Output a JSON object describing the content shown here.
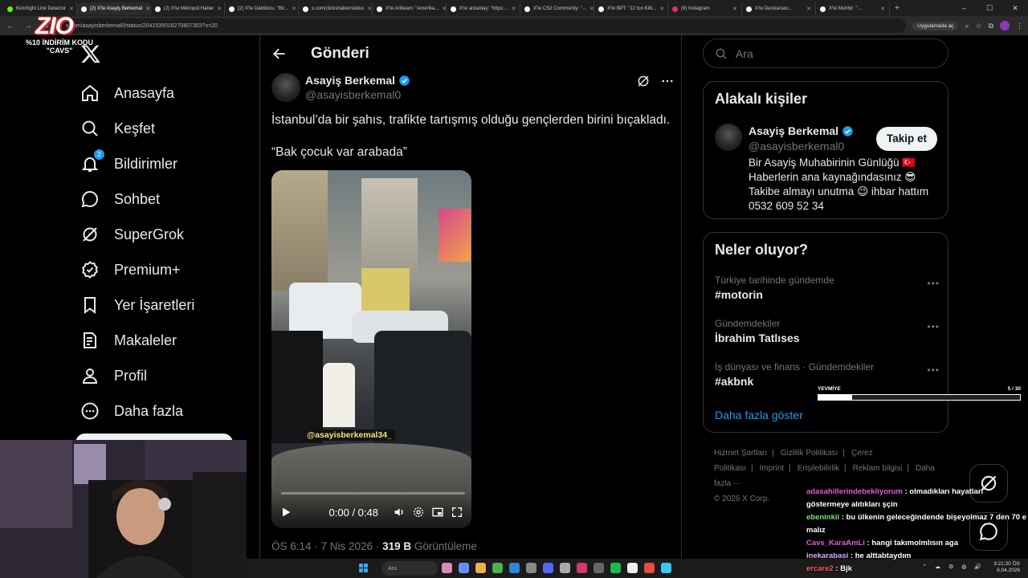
{
  "browser": {
    "tabs": [
      {
        "title": "KickSight Link Detector",
        "color": "#53fc18"
      },
      {
        "title": "(2) X'te Asayiş Berkemal",
        "color": "#ffffff",
        "active": true
      },
      {
        "title": "(2) X'te Metropol Haber",
        "color": "#ffffff"
      },
      {
        "title": "(2) X'te Daktilocu: \"Bir...",
        "color": "#ffffff"
      },
      {
        "title": "x.com/clickshaber/status",
        "color": "#ffffff"
      },
      {
        "title": "X'te Aribeam: \"Amerika...",
        "color": "#ffffff"
      },
      {
        "title": "X'te ardarday: \"https:...",
        "color": "#ffffff"
      },
      {
        "title": "X'te CS2 Community: \"...",
        "color": "#ffffff"
      },
      {
        "title": "X'te BPT: \"12 ton Kitli...",
        "color": "#ffffff"
      },
      {
        "title": "(9) Instagram",
        "color": "#e1306c"
      },
      {
        "title": "X'te Denizanası...",
        "color": "#ffffff"
      },
      {
        "title": "X'te Muhbir: \"...",
        "color": "#ffffff"
      }
    ],
    "url": "x.com/asayisberkemal0/status/2041535016270807303?s=20",
    "app_chip": "Uygulamada aç"
  },
  "overlay": {
    "logo": "ZIO",
    "promo_line1": "%10 İNDİRİM KODU",
    "promo_line2": "\"CAVS\""
  },
  "sidebar": {
    "items": [
      {
        "label": "Anasayfa",
        "icon": "home-icon"
      },
      {
        "label": "Keşfet",
        "icon": "search-icon"
      },
      {
        "label": "Bildirimler",
        "icon": "bell-icon",
        "badge": "2"
      },
      {
        "label": "Sohbet",
        "icon": "chat-icon"
      },
      {
        "label": "SuperGrok",
        "icon": "grok-icon"
      },
      {
        "label": "Premium+",
        "icon": "premium-icon"
      },
      {
        "label": "Yer İşaretleri",
        "icon": "bookmark-icon"
      },
      {
        "label": "Makaleler",
        "icon": "article-icon"
      },
      {
        "label": "Profil",
        "icon": "profile-icon"
      },
      {
        "label": "Daha fazla",
        "icon": "more-icon"
      }
    ]
  },
  "post": {
    "header_title": "Gönderi",
    "author_name": "Asayiş Berkemal",
    "author_handle": "@asayisberkemal0",
    "text": "İstanbul’da bir şahıs, trafikte tartışmış olduğu gençlerden birini bıçakladı.",
    "quote": "“Bak çocuk var arabada”",
    "video": {
      "watermark": "@asayisberkemal34_",
      "time": "0:00 / 0:48",
      "progress": 0.0
    },
    "meta_time": "ÖS 6:14 · 7 Nis 2026 · ",
    "views": "319 B",
    "views_label": " Görüntüleme"
  },
  "right": {
    "search_placeholder": "Ara",
    "related": {
      "title": "Alakalı kişiler",
      "name": "Asayiş Berkemal",
      "handle": "@asayisberkemal0",
      "follow": "Takip et",
      "bio": "Bir Asayiş Muhabirinin Günlüğü 🇹🇷 Haberlerin ana kaynağındasınız 😎 Takibe almayı unutma 😉 ihbar hattım 0532 609 52 34"
    },
    "trends": {
      "title": "Neler oluyor?",
      "items": [
        {
          "context": "Türkiye tarihinde gündemde",
          "topic": "#motorin"
        },
        {
          "context": "Gündemdekiler",
          "topic": "İbrahim Tatlıses"
        },
        {
          "context": "İş dünyası ve finans · Gündemdekiler",
          "topic": "#akbnk"
        }
      ],
      "show_more": "Daha fazla göster"
    },
    "footer": {
      "links": [
        "Hizmet Şartları",
        "|",
        "Gizlilik Politikası",
        "|",
        "Çerez Politikası",
        "|",
        "Imprint",
        "|",
        "Erişilebilirlik",
        "|",
        "Reklam bilgisi",
        "|",
        "Daha fazla ···"
      ],
      "copyright": "© 2026 X Corp."
    }
  },
  "stream": {
    "goal_label": "YEVMİYE",
    "goal_count": "5 / 30",
    "goal_fraction": 0.1667,
    "chat": [
      {
        "user": "adasahillerindebekliyorum",
        "msg": " : olmadıkları hayatları göstermeye alıtıkları şçin"
      },
      {
        "user": "ebeninkii",
        "msg": " : bu ülkenin geleceğindende bişeyolmaz 7 den 70 e malız"
      },
      {
        "user": "Cavs_KaraAmLi",
        "msg": " : hangi takımolmlısın aga"
      },
      {
        "user": "inekarabasi",
        "msg": " : he alttabtaydım"
      },
      {
        "user": "ercare2",
        "msg": " : Bjk"
      }
    ]
  },
  "taskbar": {
    "search": "Ara",
    "time": "3:21:20 ÖS",
    "date": "8.04.2026"
  }
}
